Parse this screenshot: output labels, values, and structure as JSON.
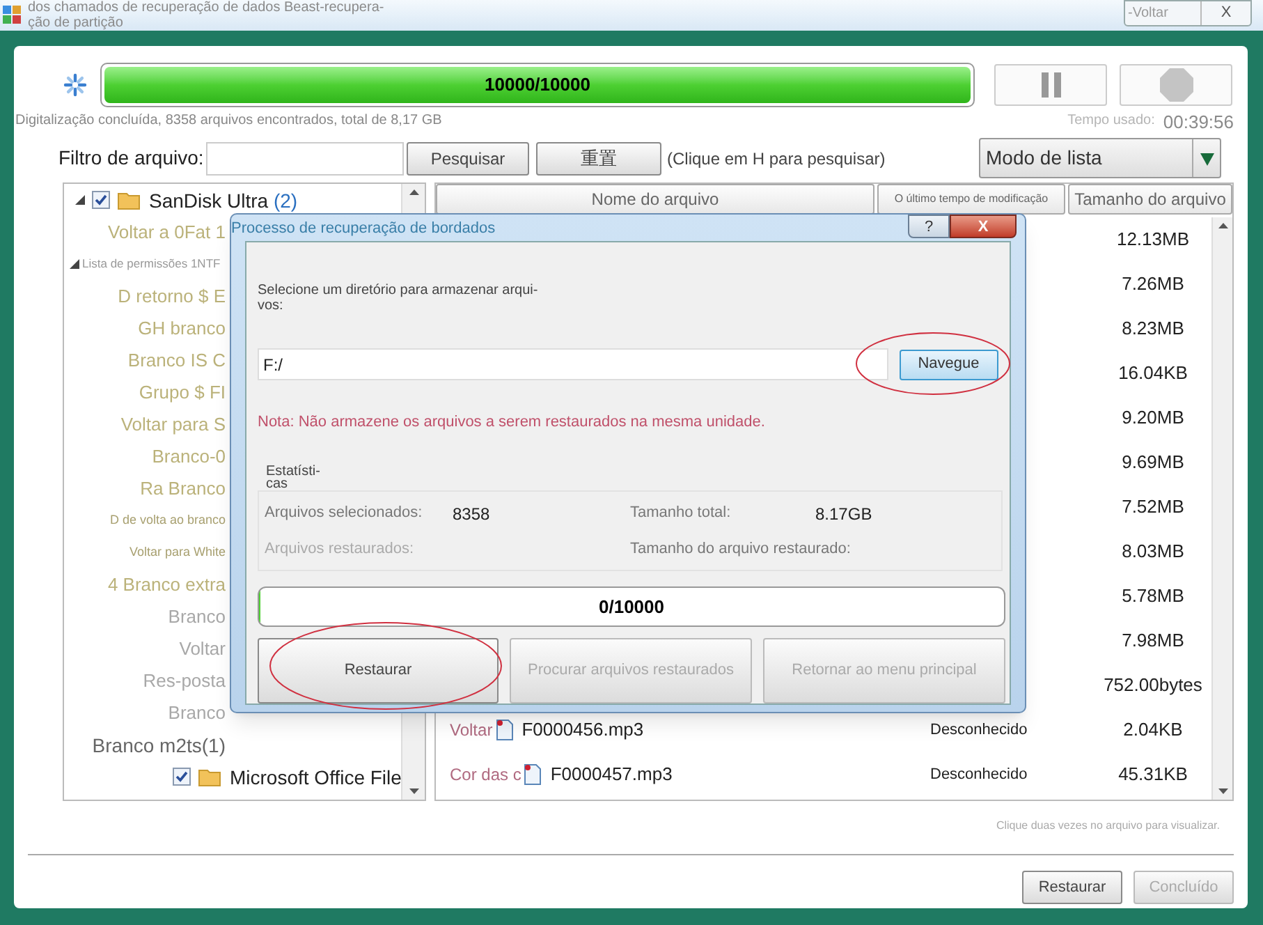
{
  "window": {
    "title_lines": [
      "dos chamados de recuperação de dados Beast-recupera-",
      "ção de partição"
    ],
    "back_button": "-Voltar",
    "close_button": "X"
  },
  "scan": {
    "level": 1,
    "progress_text": "10000/10000",
    "status": "Digitalização concluída, 8358 arquivos encontrados, total de 8,17 GB",
    "time_label": "Tempo usado:",
    "time_value": "00:39:56"
  },
  "filter": {
    "label": "Filtro de arquivo:",
    "search_button": "Pesquisar",
    "reset_button": "重置",
    "hint": "(Clique em H para pesquisar)",
    "view_mode": "Modo de lista"
  },
  "tree": [
    {
      "label": "SanDisk Ultra",
      "count": "(2)",
      "kind": "drive",
      "checked": true,
      "expanded": true,
      "children": [
        {
          "label": "Voltar a 0Fat 1",
          "kind": "entry"
        },
        {
          "label": "Lista de permissões 1NTF",
          "kind": "group",
          "expanded": true,
          "children": [
            {
              "label": "D retorno $ E",
              "kind": "entry"
            },
            {
              "label": "GH branco",
              "kind": "entry"
            },
            {
              "label": "Branco IS C",
              "kind": "entry"
            },
            {
              "label": "Grupo $ FI",
              "kind": "entry"
            },
            {
              "label": "Voltar para S",
              "kind": "entry"
            },
            {
              "label": "Branco-0",
              "kind": "entry"
            },
            {
              "label": "Ra Branco",
              "kind": "entry"
            },
            {
              "label": "D de volta ao branco",
              "kind": "small"
            },
            {
              "label": "Voltar para White",
              "kind": "small"
            },
            {
              "label": "4 Branco extra",
              "kind": "entry"
            },
            {
              "label": "Branco",
              "kind": "dim"
            },
            {
              "label": "Voltar",
              "kind": "dim"
            },
            {
              "label": "Res-posta",
              "kind": "dim"
            },
            {
              "label": "Branco",
              "kind": "dim"
            },
            {
              "label": "Branco m2ts(1)",
              "kind": "plain"
            }
          ]
        },
        {
          "label": "Microsoft Office File",
          "kind": "folder",
          "checked": true
        }
      ]
    }
  ],
  "table": {
    "columns": [
      "Nome do arquivo",
      "O último tempo de modificação",
      "Tamanho do arquivo"
    ],
    "rows": [
      {
        "size": "12.13MB"
      },
      {
        "size": "7.26MB"
      },
      {
        "size": "8.23MB"
      },
      {
        "size": "16.04KB"
      },
      {
        "size": "9.20MB"
      },
      {
        "size": "9.69MB"
      },
      {
        "size": "7.52MB"
      },
      {
        "size": "8.03MB"
      },
      {
        "size": "5.78MB"
      },
      {
        "size": "7.98MB"
      },
      {
        "size": "752.00bytes"
      },
      {
        "prefix": "Voltar",
        "name": "F0000456.mp3",
        "modified": "Desconhecido",
        "size": "2.04KB"
      },
      {
        "prefix": "Cor das c",
        "name": "F0000457.mp3",
        "modified": "Desconhecido",
        "size": "45.31KB"
      }
    ]
  },
  "preview_hint": "Clique duas vezes no arquivo para visualizar.",
  "footer_buttons": [
    {
      "label": "Restaurar",
      "disabled": false
    },
    {
      "label": "Concluído",
      "disabled": true
    }
  ],
  "dialog": {
    "title": "Processo de recuperação de bordados",
    "help_button": "?",
    "close_button": "X",
    "directory_label": "Selecione um diretório para armazenar arqui-vos:",
    "directory_value": "F:/",
    "browse_button": {
      "label": "Navegue",
      "highlighted": true
    },
    "note": "Nota: Não armazene os arquivos a serem restaurados na mesma unidade.",
    "stats_title": "Estatísti-cas",
    "stats": [
      {
        "label": "Arquivos selecionados:",
        "value": "8358",
        "disabled": false
      },
      {
        "label": "Tamanho total:",
        "value": "8.17GB",
        "disabled": false
      },
      {
        "label": "Arquivos restaurados:",
        "disabled": true
      },
      {
        "label": "Tamanho do arquivo restaurado:",
        "disabled": false
      }
    ],
    "level": 0,
    "progress_text": "0/10000",
    "buttons": [
      {
        "label": "Restaurar",
        "disabled": false,
        "highlighted": true
      },
      {
        "label": "Procurar arquivos restaurados",
        "disabled": true,
        "highlighted": false
      },
      {
        "label": "Retornar ao menu principal",
        "disabled": true,
        "highlighted": false
      }
    ]
  }
}
